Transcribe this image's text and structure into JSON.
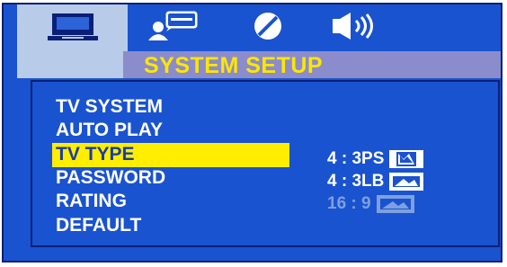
{
  "osd": {
    "title": "SYSTEM SETUP",
    "tabs": [
      {
        "icon": "tv-monitor-icon",
        "selected": true
      },
      {
        "icon": "user-speech-icon",
        "selected": false
      },
      {
        "icon": "disc-icon",
        "selected": false
      },
      {
        "icon": "speaker-icon",
        "selected": false
      }
    ],
    "menu": [
      {
        "label": "TV SYSTEM",
        "selected": false
      },
      {
        "label": "AUTO PLAY",
        "selected": false
      },
      {
        "label": "TV TYPE",
        "selected": true
      },
      {
        "label": "PASSWORD",
        "selected": false
      },
      {
        "label": "RATING",
        "selected": false
      },
      {
        "label": "DEFAULT",
        "selected": false
      }
    ],
    "options": [
      {
        "label": "4 : 3PS",
        "icon": "pan-scan-icon",
        "selected": false
      },
      {
        "label": "4 : 3LB",
        "icon": "letterbox-icon",
        "selected": false
      },
      {
        "label": "16 : 9",
        "icon": "widescreen-icon",
        "selected": true
      }
    ]
  },
  "colors": {
    "background": "#1a53cf",
    "highlight": "#ffee00",
    "title_text": "#ffe600",
    "selected_option": "#7ea0e0",
    "tab_selected": "#b8cbe9",
    "title_bar": "#8a8ccb"
  }
}
